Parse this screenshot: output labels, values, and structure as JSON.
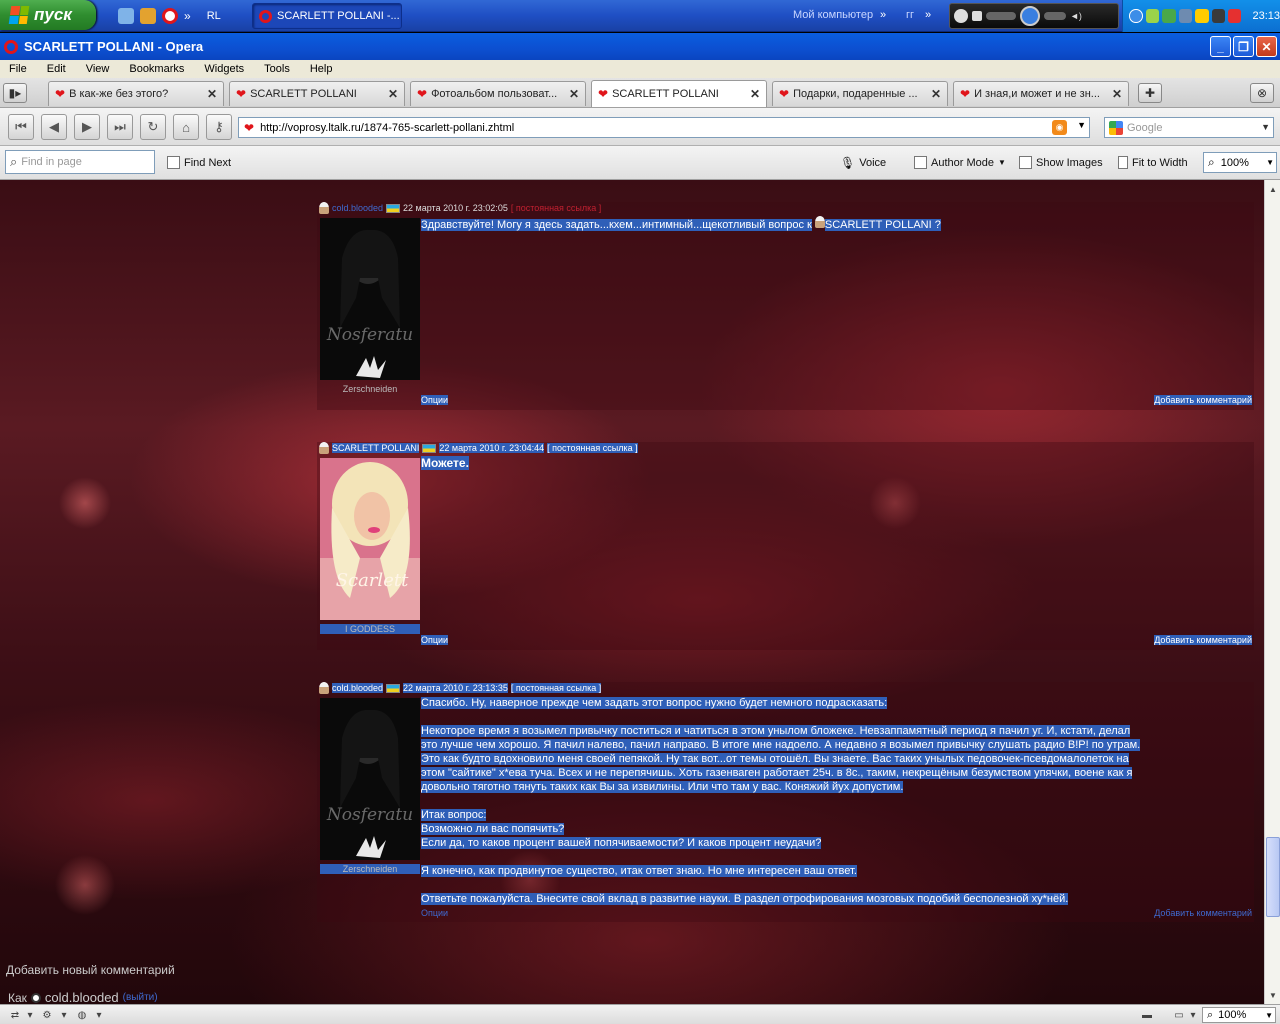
{
  "taskbar": {
    "start_label": "пуск",
    "ql_rl": "RL",
    "task_button": "SCARLETT POLLANI -...",
    "my_computer": "Мой компьютер",
    "gg": "гг",
    "clock": "23:13"
  },
  "window": {
    "title": "SCARLETT POLLANI - Opera"
  },
  "menu": [
    "File",
    "Edit",
    "View",
    "Bookmarks",
    "Widgets",
    "Tools",
    "Help"
  ],
  "tabs": [
    {
      "label": "В как-же без этого?"
    },
    {
      "label": "SCARLETT POLLANI"
    },
    {
      "label": "Фотоальбом пользоват..."
    },
    {
      "label": "SCARLETT POLLANI"
    },
    {
      "label": "Подарки, подаренные ..."
    },
    {
      "label": "И зная,и может и не зн..."
    }
  ],
  "address": {
    "url": "http://voprosy.ltalk.ru/1874-765-scarlett-pollani.zhtml",
    "search_placeholder": "Google"
  },
  "findbar": {
    "find_placeholder": "Find in page",
    "find_next": "Find Next",
    "voice": "Voice",
    "author_mode": "Author Mode",
    "show_images": "Show Images",
    "fit_to_width": "Fit to Width",
    "zoom": "100%"
  },
  "posts": [
    {
      "user": "cold.blooded",
      "date": "22 марта 2010 г. 23:02:05",
      "permalink": "[ постоянная ссылка ]",
      "signature": "Zerschneiden",
      "lines": [
        "Здравствуйте! Могу я здесь задать...кхем...интимный...щекотливый вопрос к",
        "SCARLETT POLLANI ?"
      ],
      "options": "Опции",
      "add_comment": "Добавить комментарий"
    },
    {
      "user": "SCARLETT POLLANI",
      "date": "22 марта 2010 г. 23:04:44",
      "permalink": "[ постоянная ссылка ]",
      "signature": "I GODDESS",
      "lines": [
        "Можете."
      ],
      "options": "Опции",
      "add_comment": "Добавить комментарий"
    },
    {
      "user": "cold.blooded",
      "date": "22 марта 2010 г. 23:13:35",
      "permalink": "[ постоянная ссылка ]",
      "signature": "Zerschneiden",
      "lines": [
        "Спасибо. Ну, наверное прежде чем задать этот вопрос нужно будет немного подрасказать:",
        "",
        "Некоторое время я возымел привычку поститься и чатиться в этом унылом бложеке. Невзаппамятный период я пачил уг. И, кстати, делал",
        "это лучше чем хорошо. Я пачил налево, пачил направо. В итоге мне надоело. А недавно я возымел привычку слушать радио В!Р! по утрам.",
        "Это как будто вдохновило меня своей пепякой. Ну так вот...от темы отошёл. Вы знаете. Вас таких унылых педовочек-псевдомалолеток на",
        "этом \"сайтике\" х*ева туча. Всех и не перепячишь. Хоть газенваген работает 25ч. в 8с., таким, некрещёным безумством упячки, воене как я",
        "довольно тяготно тянуть таких как Вы за извилины. Или что там у вас. Коняжий йух допустим.",
        "",
        "Итак вопрос:",
        "Возможно ли вас попячить?",
        "Если да, то каков процент вашей попячиваемости? И каков процент неудачи?",
        "",
        "Я конечно, как продвинутое существо, итак ответ знаю. Но мне интересен ваш ответ.",
        "",
        "Ответьте пожалуйста. Внесите свой вклад в развитие науки. В раздел отрофирования мозговых подобий бесполезной ху*нёй."
      ],
      "options": "Опции",
      "add_comment": "Добавить комментарий"
    }
  ],
  "new_comment": {
    "heading": "Добавить новый комментарий",
    "as_label": "Как",
    "as_user": "cold.blooded",
    "exit_link": "(выйти)"
  },
  "status": {
    "zoom": "100%"
  }
}
